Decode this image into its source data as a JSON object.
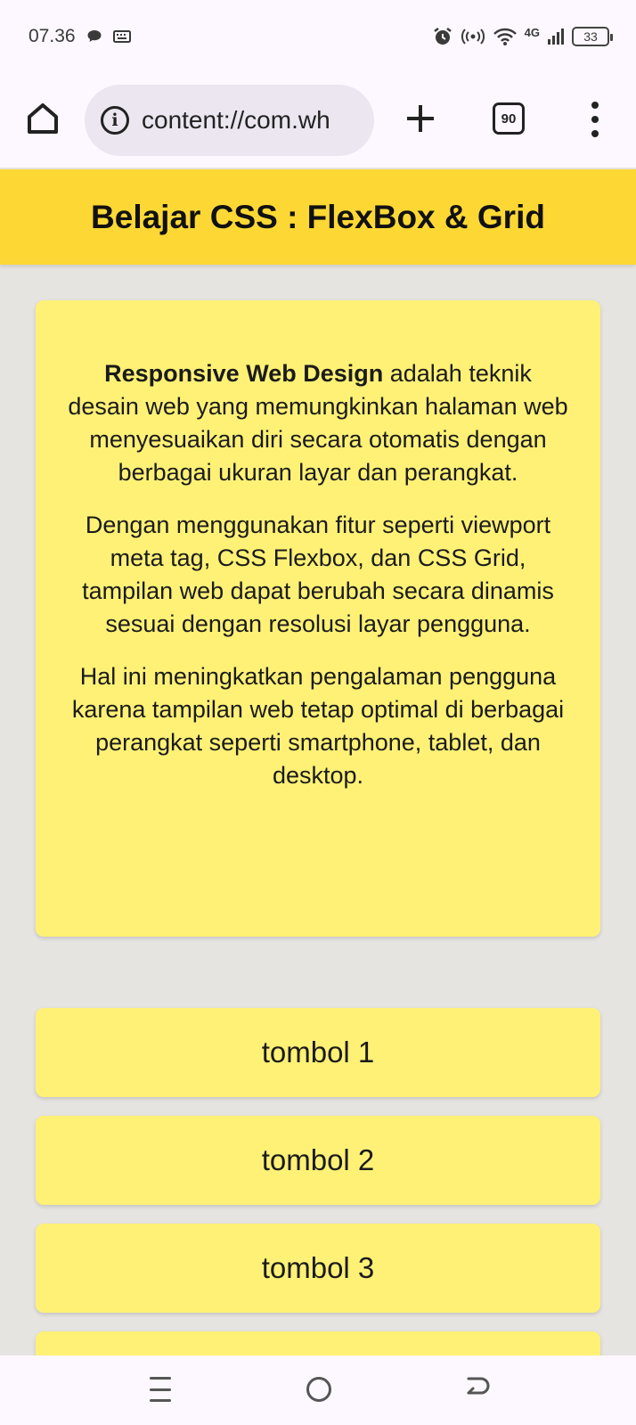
{
  "status_bar": {
    "time": "07.36",
    "network": "4G",
    "battery": "33"
  },
  "browser": {
    "url": "content://com.wh",
    "tab_count": "90"
  },
  "page": {
    "title": "Belajar CSS : FlexBox & Grid",
    "card": {
      "p1_bold": "Responsive Web Design",
      "p1_rest": " adalah teknik desain web yang memungkinkan halaman web menyesuaikan diri secara otomatis dengan berbagai ukuran layar dan perangkat.",
      "p2": "Dengan menggunakan fitur seperti viewport meta tag, CSS Flexbox, dan CSS Grid, tampilan web dapat berubah secara dinamis sesuai dengan resolusi layar pengguna.",
      "p3": "Hal ini meningkatkan pengalaman pengguna karena tampilan web tetap optimal di berbagai perangkat seperti smartphone, tablet, dan desktop."
    },
    "buttons": [
      "tombol 1",
      "tombol 2",
      "tombol 3",
      ""
    ]
  },
  "colors": {
    "header": "#fdd835",
    "card": "#fff176",
    "background": "#e6e4e1"
  },
  "icons": {
    "home": "home-icon",
    "info": "info-icon",
    "new_tab": "plus-icon",
    "tabs": "tabs-count-icon",
    "menu": "more-vert-icon"
  }
}
